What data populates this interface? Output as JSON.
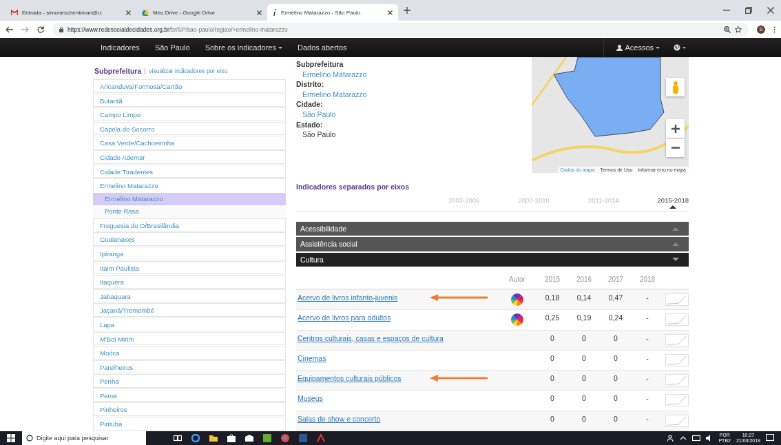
{
  "browser": {
    "tabs": [
      {
        "title": "Entrada - simoneschenkman@u:",
        "selected": false
      },
      {
        "title": "Meu Drive - Google Drive",
        "selected": false
      },
      {
        "title": "Ermelino Matarazzo - São Paulo.",
        "selected": true
      }
    ],
    "url_host": "https://www.redesocialdecidades.org.br",
    "url_path": "/br/SP/sao-paulo/regiao/+ermelino-matarazzo",
    "avatar": "S"
  },
  "navbar": {
    "items": [
      {
        "label": "Indicadores",
        "dropdown": false
      },
      {
        "label": "São Paulo",
        "dropdown": false
      },
      {
        "label": "Sobre os indicadores",
        "dropdown": true
      },
      {
        "label": "Dados abertos",
        "dropdown": false
      }
    ],
    "account": "Acessos"
  },
  "sidebar": {
    "title": "Subprefeitura",
    "link": "visualizar indicadores por eixo",
    "items": [
      {
        "label": "Aricanduva/Formosa/Carrão",
        "expanded": false
      },
      {
        "label": "Butantã",
        "expanded": false
      },
      {
        "label": "Campo Limpo",
        "expanded": false
      },
      {
        "label": "Capela do Socorro",
        "expanded": false
      },
      {
        "label": "Casa Verde/Cachoeirinha",
        "expanded": false
      },
      {
        "label": "Cidade Ademar",
        "expanded": false
      },
      {
        "label": "Cidade Tiradentes",
        "expanded": false
      },
      {
        "label": "Ermelino Matarazzo",
        "expanded": true,
        "children": [
          {
            "label": "Ermelino Matarazzo",
            "selected": true
          },
          {
            "label": "Ponte Rasa",
            "selected": false
          }
        ]
      },
      {
        "label": "Freguesia do Ó/Brasilândia",
        "expanded": false
      },
      {
        "label": "Guaianases",
        "expanded": false
      },
      {
        "label": "Ipiranga",
        "expanded": false
      },
      {
        "label": "Itaim Paulista",
        "expanded": false
      },
      {
        "label": "Itaquera",
        "expanded": false
      },
      {
        "label": "Jabaquara",
        "expanded": false
      },
      {
        "label": "Jaçanã/Tremembé",
        "expanded": false
      },
      {
        "label": "Lapa",
        "expanded": false
      },
      {
        "label": "M'Boi Mirim",
        "expanded": false
      },
      {
        "label": "Moóca",
        "expanded": false
      },
      {
        "label": "Parelheiros",
        "expanded": false
      },
      {
        "label": "Penha",
        "expanded": false
      },
      {
        "label": "Perus",
        "expanded": false
      },
      {
        "label": "Pinheiros",
        "expanded": false
      },
      {
        "label": "Pirituba",
        "expanded": false
      }
    ]
  },
  "location": [
    {
      "label": "Subprefeitura",
      "value": "Ermelino Matarazzo",
      "link": true
    },
    {
      "label": "Distrito:",
      "value": "Ermelino Matarazzo",
      "link": true
    },
    {
      "label": "Cidade:",
      "value": "São Paulo",
      "link": true
    },
    {
      "label": "Estado:",
      "value": "São Paulo",
      "link": false
    }
  ],
  "map": {
    "links": [
      "Dados do mapa",
      "Termos de Uso",
      "Informar erro no mapa"
    ]
  },
  "indicators": {
    "title": "Indicadores separados por eixos",
    "periods": [
      {
        "label": "2003-2006",
        "selected": false
      },
      {
        "label": "2007-2010",
        "selected": false
      },
      {
        "label": "2011-2014",
        "selected": false
      },
      {
        "label": "2015-2018",
        "selected": true
      }
    ],
    "sections": [
      {
        "label": "Acessibilidade",
        "expanded": false
      },
      {
        "label": "Assistência social",
        "expanded": false
      },
      {
        "label": "Cultura",
        "expanded": true
      }
    ],
    "columns": [
      "Autor",
      "2015",
      "2016",
      "2017",
      "2018"
    ],
    "rows": [
      {
        "name": "Acervo de livros infanto-juvenis",
        "author_icon": true,
        "annotated": true,
        "values": [
          "0,18",
          "0,14",
          "0,47",
          "-"
        ]
      },
      {
        "name": "Acervo de livros para adultos",
        "author_icon": true,
        "annotated": false,
        "values": [
          "0,25",
          "0,19",
          "0,24",
          "-"
        ]
      },
      {
        "name": "Centros culturais, casas e espaços de cultura",
        "author_icon": false,
        "annotated": false,
        "values": [
          "0",
          "0",
          "0",
          "-"
        ]
      },
      {
        "name": "Cinemas",
        "author_icon": false,
        "annotated": false,
        "values": [
          "0",
          "0",
          "0",
          "-"
        ]
      },
      {
        "name": "Equipamentos culturais públicos",
        "author_icon": false,
        "annotated": true,
        "values": [
          "0",
          "0",
          "0",
          "-"
        ]
      },
      {
        "name": "Museus",
        "author_icon": false,
        "annotated": false,
        "values": [
          "0",
          "0",
          "0",
          "-"
        ]
      },
      {
        "name": "Salas de show e concerto",
        "author_icon": false,
        "annotated": false,
        "values": [
          "0",
          "0",
          "0",
          "-"
        ]
      }
    ]
  },
  "taskbar": {
    "search_placeholder": "Digite aqui para pesquisar",
    "language": "POR",
    "layout": "PTB2",
    "time": "10:27",
    "date": "21/03/2019"
  }
}
